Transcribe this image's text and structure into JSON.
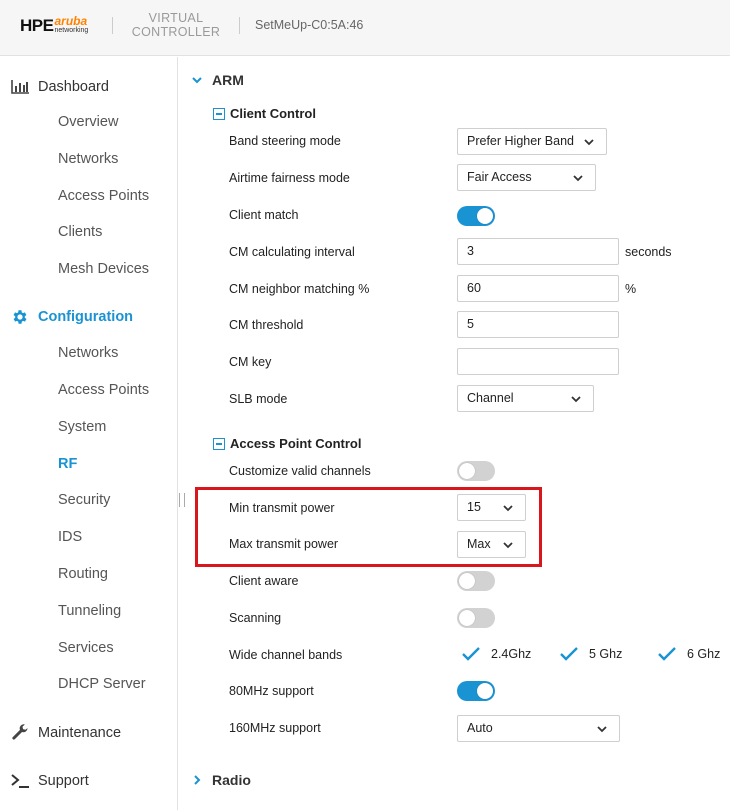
{
  "header": {
    "logo_brand": "HPE",
    "logo_sub1": "aruba",
    "logo_sub2": "networking",
    "product_line1": "VIRTUAL",
    "product_line2": "CONTROLLER",
    "device_name": "SetMeUp-C0:5A:46"
  },
  "sidebar": {
    "dashboard": "Dashboard",
    "dashboard_items": [
      "Overview",
      "Networks",
      "Access Points",
      "Clients",
      "Mesh Devices"
    ],
    "configuration": "Configuration",
    "configuration_items": [
      "Networks",
      "Access Points",
      "System",
      "RF",
      "Security",
      "IDS",
      "Routing",
      "Tunneling",
      "Services",
      "DHCP Server"
    ],
    "active_item": "RF",
    "maintenance": "Maintenance",
    "support": "Support"
  },
  "main": {
    "arm_title": "ARM",
    "client_control": {
      "title": "Client Control",
      "band_steering_label": "Band steering mode",
      "band_steering_value": "Prefer Higher Band",
      "airtime_label": "Airtime fairness mode",
      "airtime_value": "Fair Access",
      "client_match_label": "Client match",
      "client_match_on": true,
      "cm_interval_label": "CM calculating interval",
      "cm_interval_value": "3",
      "cm_interval_unit": "seconds",
      "cm_neighbor_label": "CM neighbor matching %",
      "cm_neighbor_value": "60",
      "cm_neighbor_unit": "%",
      "cm_threshold_label": "CM threshold",
      "cm_threshold_value": "5",
      "cm_key_label": "CM key",
      "cm_key_value": "",
      "slb_label": "SLB mode",
      "slb_value": "Channel"
    },
    "ap_control": {
      "title": "Access Point Control",
      "custom_channels_label": "Customize valid channels",
      "custom_channels_on": false,
      "min_power_label": "Min transmit power",
      "min_power_value": "15",
      "max_power_label": "Max transmit power",
      "max_power_value": "Max",
      "client_aware_label": "Client aware",
      "client_aware_on": false,
      "scanning_label": "Scanning",
      "scanning_on": false,
      "wide_bands_label": "Wide channel bands",
      "band_24": "2.4Ghz",
      "band_5": "5 Ghz",
      "band_6": "6 Ghz",
      "support_80_label": "80MHz support",
      "support_80_on": true,
      "support_160_label": "160MHz support",
      "support_160_value": "Auto"
    },
    "radio_title": "Radio"
  },
  "colors": {
    "accent": "#1a93d3",
    "highlight": "#d8161b",
    "brand_orange": "#ff8300"
  }
}
